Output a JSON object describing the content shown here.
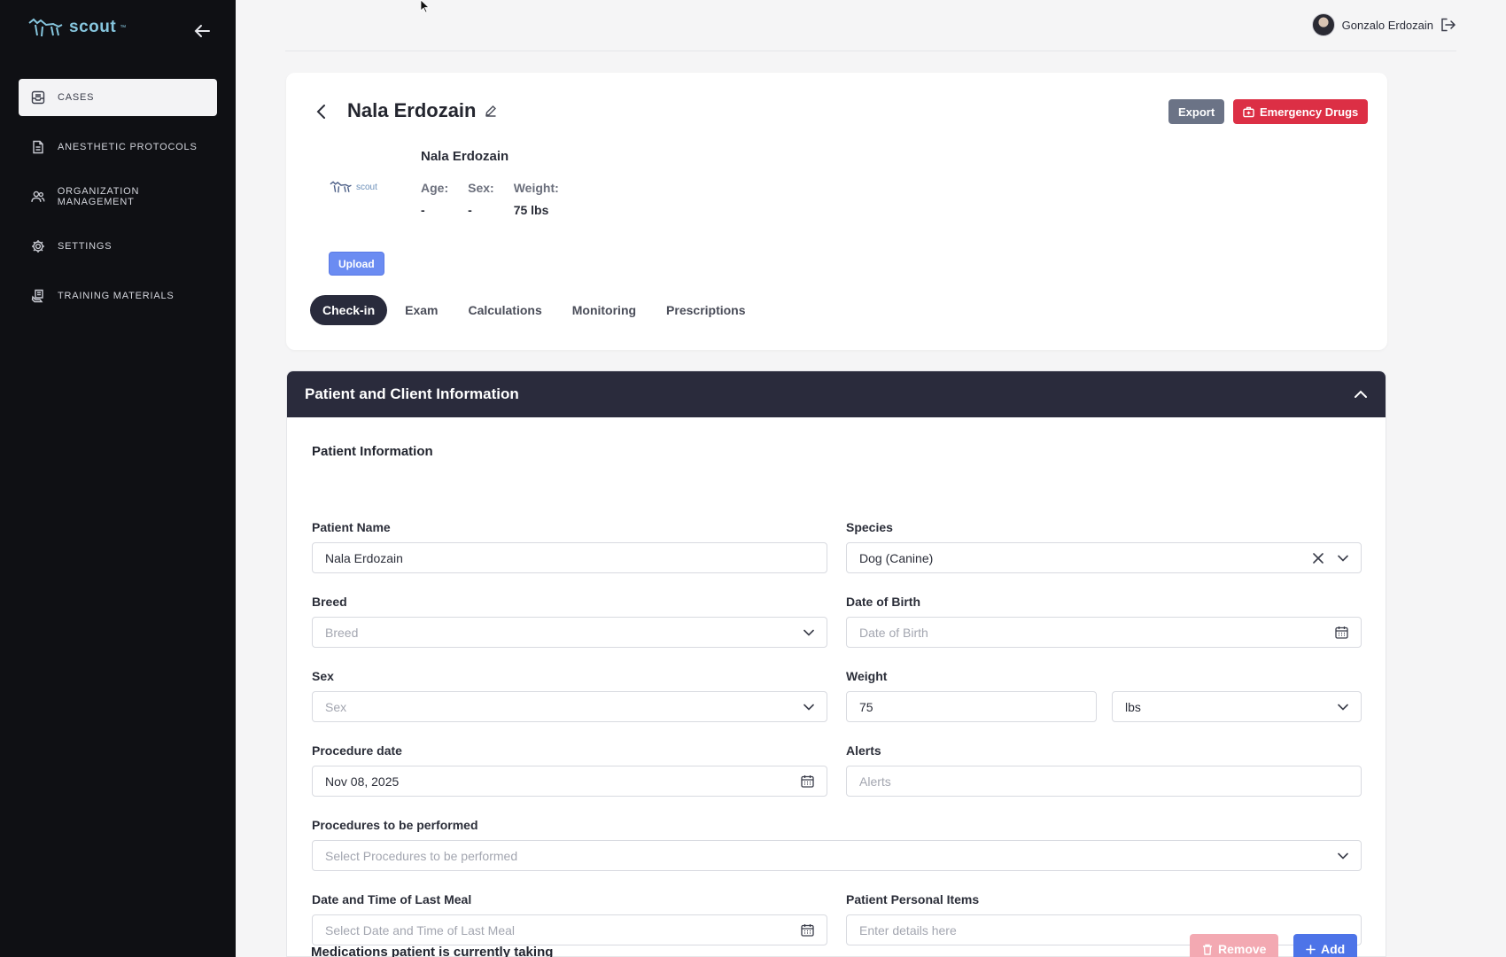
{
  "sidebar": {
    "brand": "scout",
    "brand_mark": "™",
    "items": [
      {
        "label": "CASES",
        "icon": "inbox-icon",
        "active": true
      },
      {
        "label": "ANESTHETIC PROTOCOLS",
        "icon": "document-icon"
      },
      {
        "label": "ORGANIZATION MANAGEMENT",
        "icon": "users-icon"
      },
      {
        "label": "SETTINGS",
        "icon": "gear-icon"
      },
      {
        "label": "TRAINING MATERIALS",
        "icon": "book-hand-icon"
      }
    ]
  },
  "topbar": {
    "user_name": "Gonzalo Erdozain"
  },
  "patient_card": {
    "title": "Nala Erdozain",
    "export_label": "Export",
    "emergency_label": "Emergency Drugs",
    "thumb_text": "scout",
    "name": "Nala Erdozain",
    "age_label": "Age:",
    "age_value": "-",
    "sex_label": "Sex:",
    "sex_value": "-",
    "weight_label": "Weight:",
    "weight_value": "75 lbs",
    "upload_label": "Upload",
    "tabs": [
      "Check-in",
      "Exam",
      "Calculations",
      "Monitoring",
      "Prescriptions"
    ]
  },
  "section": {
    "title": "Patient and Client Information",
    "subheading": "Patient Information",
    "fields": {
      "patient_name": {
        "label": "Patient Name",
        "value": "Nala Erdozain"
      },
      "species": {
        "label": "Species",
        "value": "Dog (Canine)"
      },
      "breed": {
        "label": "Breed",
        "placeholder": "Breed"
      },
      "dob": {
        "label": "Date of Birth",
        "placeholder": "Date of Birth"
      },
      "sex": {
        "label": "Sex",
        "placeholder": "Sex"
      },
      "weight": {
        "label": "Weight",
        "value": "75",
        "unit": "lbs"
      },
      "procedure_date": {
        "label": "Procedure date",
        "value": "Nov 08, 2025"
      },
      "alerts": {
        "label": "Alerts",
        "placeholder": "Alerts"
      },
      "procedures": {
        "label": "Procedures to be performed",
        "placeholder": "Select Procedures to be performed"
      },
      "last_meal": {
        "label": "Date and Time of Last Meal",
        "placeholder": "Select Date and Time of Last Meal"
      },
      "personal_items": {
        "label": "Patient Personal Items",
        "placeholder": "Enter details here"
      }
    },
    "medications_heading": "Medications patient is currently taking",
    "remove_label": "Remove",
    "add_label": "Add"
  },
  "colors": {
    "sidebar_bg": "#0f1014",
    "section_header": "#2a2b3c",
    "emergency": "#dc2f45",
    "add": "#4d74e8",
    "brand": "#86c6de"
  }
}
